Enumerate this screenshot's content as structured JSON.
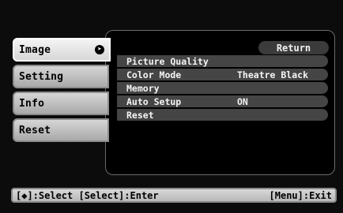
{
  "sidebar": {
    "tabs": [
      {
        "label": "Image"
      },
      {
        "label": "Setting"
      },
      {
        "label": "Info"
      },
      {
        "label": "Reset"
      }
    ],
    "enter_icon": "enter-icon"
  },
  "menu": {
    "return_label": "Return",
    "items": [
      {
        "label": "Picture Quality",
        "value": ""
      },
      {
        "label": "Color Mode",
        "value": "Theatre Black"
      },
      {
        "label": "Memory",
        "value": ""
      },
      {
        "label": "Auto Setup",
        "value": "ON"
      },
      {
        "label": "Reset",
        "value": ""
      }
    ]
  },
  "statusbar": {
    "left": "[◆]:Select [Select]:Enter",
    "right": "[Menu]:Exit"
  },
  "colors": {
    "background": "#0c0c0c",
    "row": "#454545",
    "tab": "#c8c8c8"
  }
}
